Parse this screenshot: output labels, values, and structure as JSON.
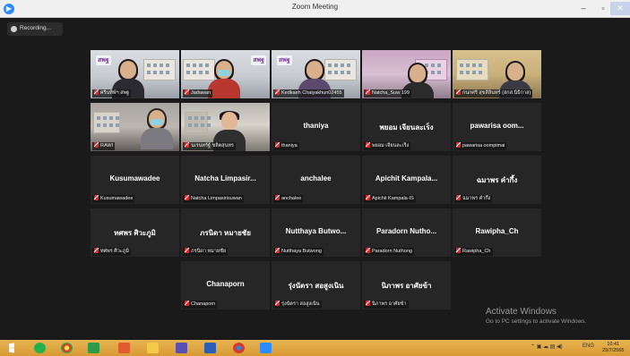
{
  "window": {
    "title": "Zoom Meeting",
    "minimize": "–",
    "maximize": "▫",
    "close": "✕"
  },
  "recording": {
    "label": "Recording..."
  },
  "tiles": [
    {
      "tag": "ศรีนทิพ์ฯ สพฐ",
      "video": true
    },
    {
      "tag": "Jadawan",
      "video": true
    },
    {
      "tag": "Kedkaeh Chaiyakhun02455",
      "video": true,
      "active": true
    },
    {
      "tag": "Natcha_Suw 199",
      "video": true
    },
    {
      "tag": "กนกศรี สุขสิลินทร์ (สกส.นิธิกาล)",
      "video": true
    },
    {
      "tag": "RAWI",
      "video": true
    },
    {
      "tag": "นเรนทร์ฐ์ ชลิตสุนทร",
      "video": true
    },
    {
      "name": "thaniya",
      "tag": "thaniya"
    },
    {
      "name": "พยอม เจียนละเร็ง",
      "tag": "พยอม เจียนละเร็ง"
    },
    {
      "name": "pawarisa   oom...",
      "tag": "pawarisa   oompimai"
    },
    {
      "name": "Kusumawadee",
      "tag": "Kusumawadee"
    },
    {
      "name": "Natcha  Limpasir...",
      "tag": "Natcha Limpasirisuwan"
    },
    {
      "name": "anchalee",
      "tag": "anchalee"
    },
    {
      "name": "Apichit  Kampala...",
      "tag": "Apichit Kampala-IS"
    },
    {
      "name": "ฉมาพร คำกึ้ง",
      "tag": "ฉมาพร คำกึ้ง"
    },
    {
      "name": "ทศพร ศิวะภูมิ",
      "tag": "ทศพร ศิวะภูมิ"
    },
    {
      "name": "ภรนิดา หมายชัย",
      "tag": "ภรนิดา หมายชัย"
    },
    {
      "name": "Nutthaya  Butwo...",
      "tag": "Nutthaya Butwong"
    },
    {
      "name": "Paradorn  Nutho...",
      "tag": "Paradorn Nuthong"
    },
    {
      "name": "Rawipha_Ch",
      "tag": "Rawipha_Ch"
    },
    {
      "name": "Chanaporn",
      "tag": "Chanaporn"
    },
    {
      "name": "รุ่งนัตรา สอสูงเนิน",
      "tag": "รุ่งนัตรา สอสูงเนิน"
    },
    {
      "name": "นิภาพร อาศัยข้า",
      "tag": "นิภาพร อาศัยข้า"
    }
  ],
  "watermark": {
    "title": "Activate Windows",
    "subtitle": "Go to PC settings to activate Windows."
  },
  "taskbar": {
    "time": "10:41",
    "date": "29/7/2565",
    "lang": "ENG"
  }
}
